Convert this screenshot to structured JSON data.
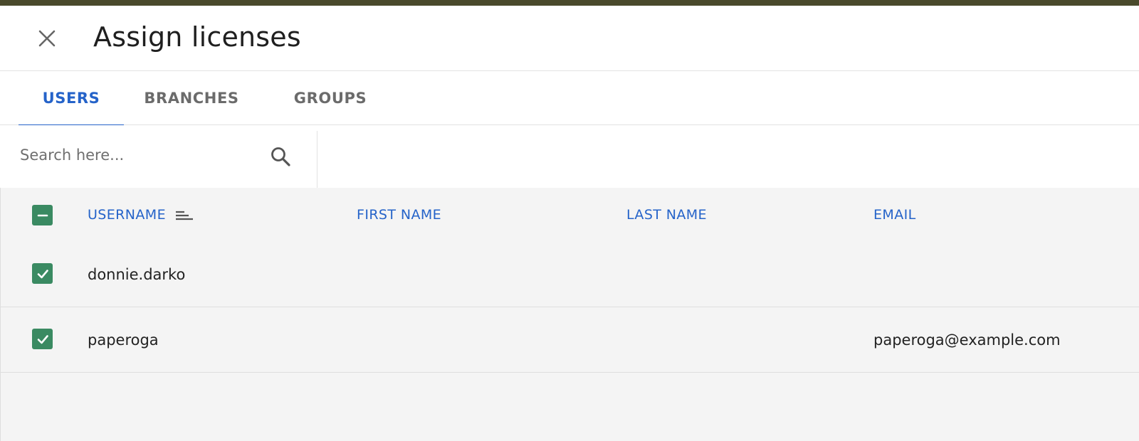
{
  "dialog": {
    "title": "Assign licenses"
  },
  "tabs": [
    {
      "label": "USERS",
      "active": true
    },
    {
      "label": "BRANCHES",
      "active": false
    },
    {
      "label": "GROUPS",
      "active": false
    }
  ],
  "search": {
    "placeholder": "Search here...",
    "value": ""
  },
  "table": {
    "columns": [
      "USERNAME",
      "FIRST NAME",
      "LAST NAME",
      "EMAIL"
    ],
    "sorted_column": "USERNAME",
    "select_all_state": "indeterminate",
    "rows": [
      {
        "selected": true,
        "username": "donnie.darko",
        "first_name": "",
        "last_name": "",
        "email": ""
      },
      {
        "selected": true,
        "username": "paperoga",
        "first_name": "",
        "last_name": "",
        "email": "paperoga@example.com"
      }
    ]
  },
  "colors": {
    "accent": "#2563c9",
    "checkbox": "#3a8a62",
    "top_strip": "#4a4a2c",
    "table_bg": "#f4f4f4"
  },
  "icons": {
    "close": "close-icon",
    "search": "search-icon",
    "sort": "sort-icon",
    "check": "check-icon",
    "indeterminate": "minus-icon"
  }
}
